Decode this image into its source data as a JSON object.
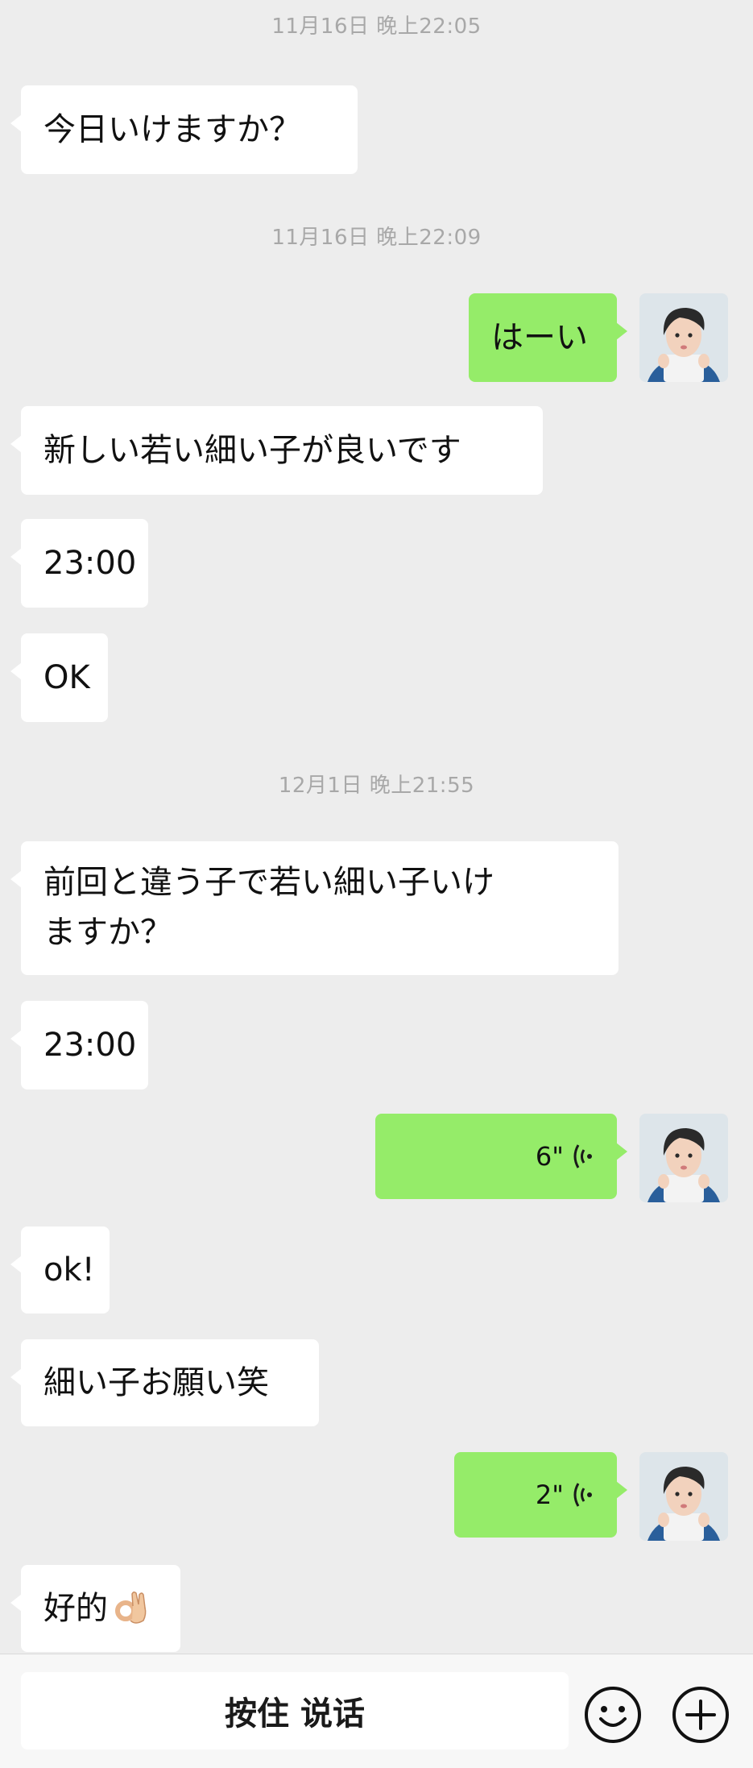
{
  "timestamps": [
    "11月16日 晚上22:05",
    "11月16日 晚上22:09",
    "12月1日 晚上21:55"
  ],
  "messages": [
    {
      "dir": "in",
      "text": "今日いけますか？"
    },
    {
      "dir": "out",
      "text": "はーい"
    },
    {
      "dir": "in",
      "text": "新しい若い細い子が良いです"
    },
    {
      "dir": "in",
      "text": "23:00"
    },
    {
      "dir": "in",
      "text": "OK"
    },
    {
      "dir": "in",
      "line1": "前回と違う子で若い細い子いけ",
      "line2": "ますか？"
    },
    {
      "dir": "in",
      "text": "23:00"
    },
    {
      "dir": "out",
      "type": "voice",
      "duration": "6\""
    },
    {
      "dir": "in",
      "text": "ok!"
    },
    {
      "dir": "in",
      "text": "細い子お願い笑"
    },
    {
      "dir": "out",
      "type": "voice",
      "duration": "2\""
    },
    {
      "dir": "in",
      "text": "好的",
      "emoji": "ok-hand-emoji"
    }
  ],
  "bottom_bar": {
    "hold_to_talk_label": "按住 说话",
    "emoji_button_icon": "smiley-face-icon",
    "more_button_icon": "plus-circle-icon"
  },
  "colors": {
    "background": "#ededed",
    "incoming_bubble": "#ffffff",
    "outgoing_bubble": "#95ec69",
    "timestamp_text": "#a8a8a8"
  }
}
